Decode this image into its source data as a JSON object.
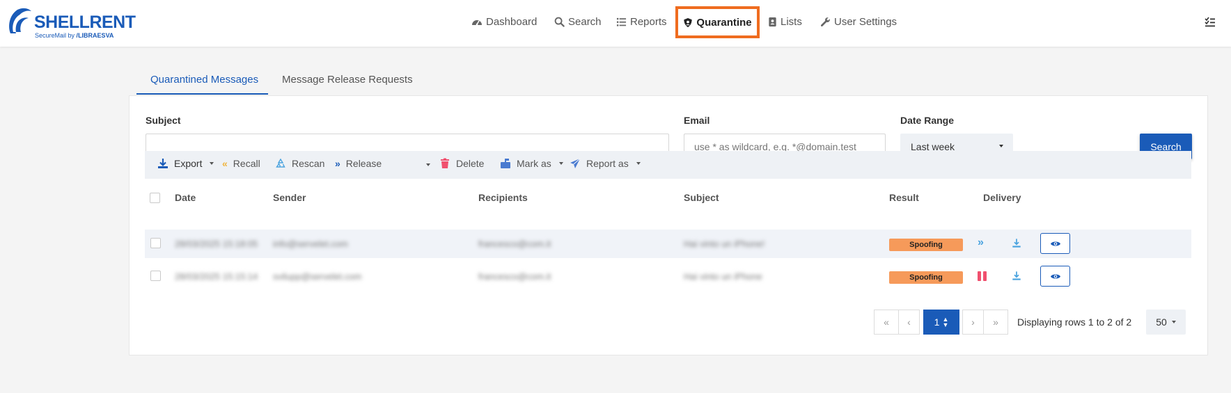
{
  "brand": {
    "name": "SHELLRENT",
    "tagline_prefix": "SecureMail by",
    "tagline_brand": "LIBRAESVA"
  },
  "nav": {
    "items": [
      {
        "label": "Dashboard",
        "icon": "dashboard-icon"
      },
      {
        "label": "Search",
        "icon": "search-icon"
      },
      {
        "label": "Reports",
        "icon": "list-icon"
      },
      {
        "label": "Quarantine",
        "icon": "shield-icon",
        "active": true
      },
      {
        "label": "Lists",
        "icon": "contact-book-icon"
      },
      {
        "label": "User Settings",
        "icon": "wrench-icon"
      }
    ]
  },
  "tabs": {
    "active": "Quarantined Messages",
    "other": "Message Release Requests"
  },
  "filters": {
    "subject_label": "Subject",
    "subject_value": "",
    "email_label": "Email",
    "email_placeholder": "use * as wildcard, e.g. *@domain.test",
    "date_label": "Date Range",
    "date_value": "Last week",
    "search_button": "Search"
  },
  "toolbar": {
    "export": "Export",
    "recall": "Recall",
    "rescan": "Rescan",
    "release": "Release",
    "delete": "Delete",
    "mark_as": "Mark as",
    "report_as": "Report as"
  },
  "table": {
    "headers": {
      "date": "Date",
      "sender": "Sender",
      "recipients": "Recipients",
      "subject": "Subject",
      "result": "Result",
      "delivery": "Delivery"
    },
    "rows": [
      {
        "date": "28/03/2025 15:18:05",
        "sender": "info@servelet.com",
        "recipients": "francesco@com.it",
        "subject": "Hai vinto un iPhone!",
        "result": "Spoofing",
        "delivery": "forwarded-icon"
      },
      {
        "date": "28/03/2025 15:15:14",
        "sender": "svilupp@servelet.com",
        "recipients": "francesco@com.it",
        "subject": "Hai vinto un iPhone",
        "result": "Spoofing",
        "delivery": "paused-icon"
      }
    ]
  },
  "pagination": {
    "current_page": "1",
    "info": "Displaying rows 1 to 2 of 2",
    "page_size": "50"
  },
  "colors": {
    "primary": "#1a5bb8",
    "highlight": "#ef6c1f",
    "badge": "#f69a5a",
    "paused": "#f0506e"
  }
}
